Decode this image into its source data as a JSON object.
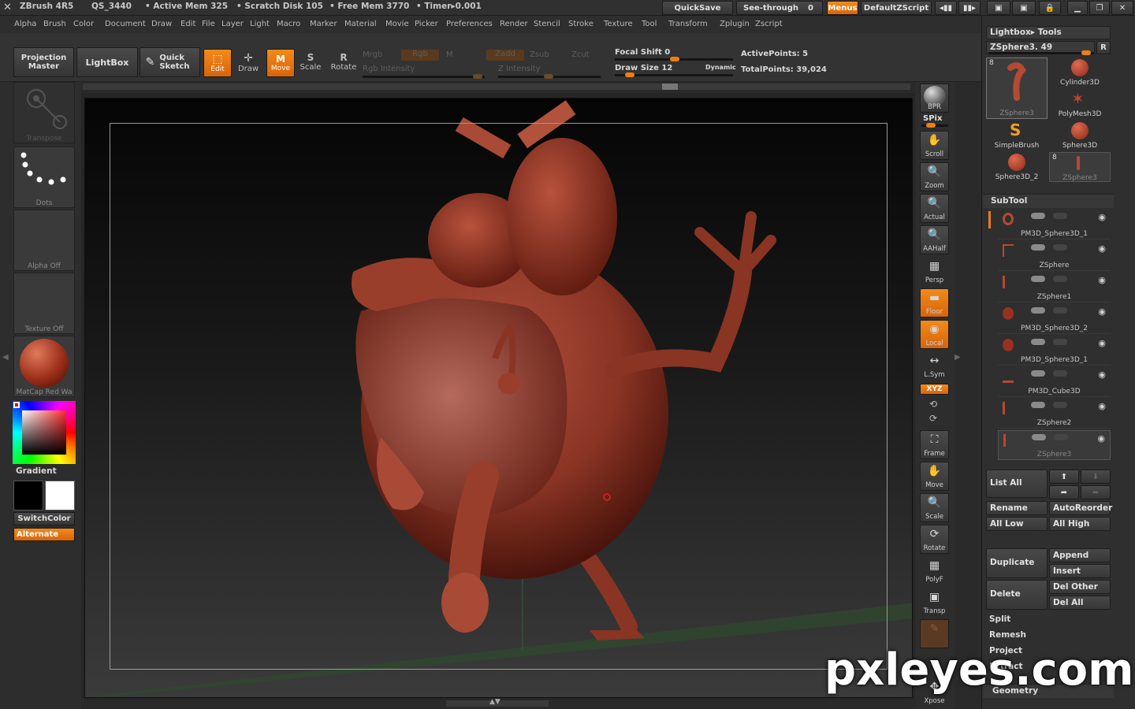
{
  "titlebar": {
    "app": "ZBrush 4R5",
    "qs": "QS_3440",
    "active_mem": "• Active Mem 325",
    "scratch": "• Scratch Disk 105",
    "free_mem": "• Free Mem 3770",
    "timer": "• Timer▸0.001",
    "quicksave": "QuickSave",
    "seethrough": "See-through",
    "seethrough_val": "0",
    "menus": "Menus",
    "script": "DefaultZScript"
  },
  "menubar": [
    "Alpha",
    "Brush",
    "Color",
    "Document",
    "Draw",
    "Edit",
    "File",
    "Layer",
    "Light",
    "Macro",
    "Marker",
    "Material",
    "Movie",
    "Picker",
    "Preferences",
    "Render",
    "Stencil",
    "Stroke",
    "Texture",
    "Tool",
    "Transform",
    "Zplugin",
    "Zscript"
  ],
  "toolbar": {
    "projection_master": "Projection Master",
    "lightbox": "LightBox",
    "quick_sketch": "Quick Sketch",
    "edit": "Edit",
    "draw": "Draw",
    "move": "Move",
    "scale": "Scale",
    "rotate": "Rotate",
    "mrgb": "Mrgb",
    "rgb": "Rgb",
    "m": "M",
    "zadd": "Zadd",
    "zsub": "Zsub",
    "zcut": "Zcut",
    "rgb_intensity": "Rgb Intensity",
    "z_intensity": "Z Intensity",
    "focal_shift": "Focal Shift 0",
    "draw_size": "Draw Size 12",
    "dynamic": "Dynamic",
    "active_points": "ActivePoints: 5",
    "total_points": "TotalPoints: 39,024"
  },
  "lefttray": {
    "transpose": "Transpose",
    "dots": "Dots",
    "alpha": "Alpha Off",
    "texture": "Texture Off",
    "matcap": "MatCap Red Wa",
    "gradient": "Gradient",
    "switchcolor": "SwitchColor",
    "alternate": "Alternate"
  },
  "shelf": [
    {
      "label": "BPR",
      "icon": "●"
    },
    {
      "label": "Scroll",
      "icon": "✋"
    },
    {
      "label": "Zoom",
      "icon": "🔍"
    },
    {
      "label": "Actual",
      "icon": "🔍"
    },
    {
      "label": "AAHalf",
      "icon": "🔍"
    },
    {
      "label": "Persp",
      "icon": "▦"
    },
    {
      "label": "Floor",
      "icon": "▬"
    },
    {
      "label": "Local",
      "icon": "◉"
    },
    {
      "label": "L.Sym",
      "icon": "↔"
    },
    {
      "label": "Frame",
      "icon": "⛶"
    },
    {
      "label": "Move",
      "icon": "✋"
    },
    {
      "label": "Scale",
      "icon": "🔍"
    },
    {
      "label": "Rotate",
      "icon": "⟳"
    },
    {
      "label": "PolyF",
      "icon": "▦"
    },
    {
      "label": "Transp",
      "icon": "▣"
    },
    {
      "label": "Xpose",
      "icon": "✥"
    }
  ],
  "shelf_extra": {
    "spix": "SPix",
    "xyz": "XYZ"
  },
  "rpanel": {
    "lightbox_tools": "Lightbox▸ Tools",
    "current_tool": "ZSphere3. 49",
    "r": "R",
    "tools": [
      {
        "name": "ZSphere3",
        "badge": "8"
      },
      {
        "name": "Cylinder3D",
        "badge": ""
      },
      {
        "name": "PolyMesh3D",
        "badge": ""
      },
      {
        "name": "SimpleBrush",
        "badge": ""
      },
      {
        "name": "Sphere3D",
        "badge": ""
      },
      {
        "name": "Sphere3D_2",
        "badge": ""
      },
      {
        "name": "ZSphere3",
        "badge": "8"
      }
    ],
    "subtool_title": "SubTool",
    "subtools": [
      "PM3D_Sphere3D_1",
      "ZSphere",
      "ZSphere1",
      "PM3D_Sphere3D_2",
      "PM3D_Sphere3D_1",
      "PM3D_Cube3D",
      "ZSphere2",
      "ZSphere3"
    ],
    "list_all": "List All",
    "rename": "Rename",
    "autoreorder": "AutoReorder",
    "all_low": "All Low",
    "all_high": "All High",
    "duplicate": "Duplicate",
    "append": "Append",
    "insert": "Insert",
    "delete": "Delete",
    "del_other": "Del Other",
    "del_all": "Del All",
    "split": "Split",
    "remesh": "Remesh",
    "project": "Project",
    "extract": "Extract",
    "geometry": "Geometry"
  },
  "watermark": "pxleyes.com"
}
